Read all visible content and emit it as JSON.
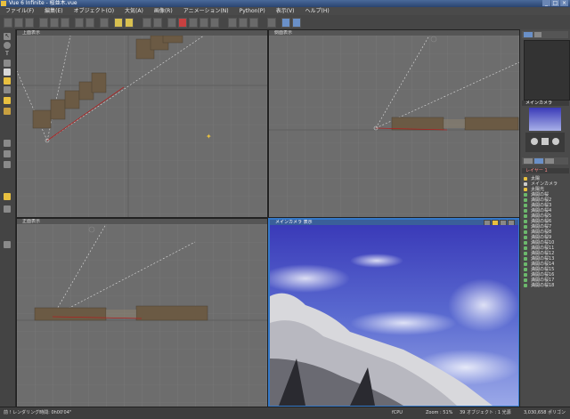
{
  "app": {
    "title": "Vue 6 Infinite - 桜並木.vue",
    "window_buttons": [
      "_",
      "□",
      "×"
    ]
  },
  "menu": [
    "ファイル(F)",
    "編集(E)",
    "オブジェクト(O)",
    "大気(A)",
    "画像(R)",
    "アニメーション(N)",
    "Python(P)",
    "表示(V)",
    "ヘルプ(H)"
  ],
  "viewports": {
    "top": "上面表示",
    "side": "側面表示",
    "front": "正面表示",
    "camera": "メインカメラ 表示"
  },
  "panel": {
    "camera_title": "メインカメラ",
    "layer": "レイヤー 1"
  },
  "objects": [
    "太陽",
    "メインカメラ",
    "太陽光",
    "満開の桜",
    "満開の桜2",
    "満開の桜3",
    "満開の桜4",
    "満開の桜5",
    "満開の桜6",
    "満開の桜7",
    "満開の桜8",
    "満開の桜9",
    "満開の桜10",
    "満開の桜11",
    "満開の桜12",
    "満開の桜13",
    "満開の桜14",
    "満開の桜15",
    "満開の桜16",
    "満開の桜17",
    "満開の桜18"
  ],
  "status": {
    "render_time": "前 ! レンダリング時間: 0h00'04\"",
    "fps": "fCPU",
    "zoom": "Zoom : 51%",
    "object_count": "39 オブジェクト : 1 光源",
    "polygons": "3,030,658 ポリゴン"
  },
  "colors": {
    "viewport_bg": "#6d6d6d",
    "active_border": "#3478c8",
    "sky_top": "#3a3ab8",
    "tree_block": "#6b5a44"
  }
}
